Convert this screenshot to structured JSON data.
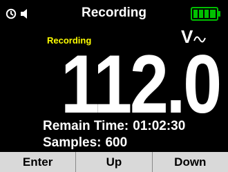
{
  "status_bar": {
    "title": "Recording",
    "icons": [
      "timer-icon",
      "speaker-icon",
      "battery-icon"
    ],
    "battery_level": 1.0,
    "colors": {
      "battery": "#00c000"
    }
  },
  "measurement": {
    "mode_label": "Recording",
    "value": "112.0",
    "unit": "V",
    "unit_icon": "ac-wave-icon",
    "colors": {
      "mode_label": "#ffff00"
    }
  },
  "info": {
    "remain_label": "Remain Time:",
    "remain_value": "01:02:30",
    "samples_label": "Samples:",
    "samples_value": "600"
  },
  "softkeys": [
    {
      "label": "Enter"
    },
    {
      "label": "Up"
    },
    {
      "label": "Down"
    }
  ]
}
